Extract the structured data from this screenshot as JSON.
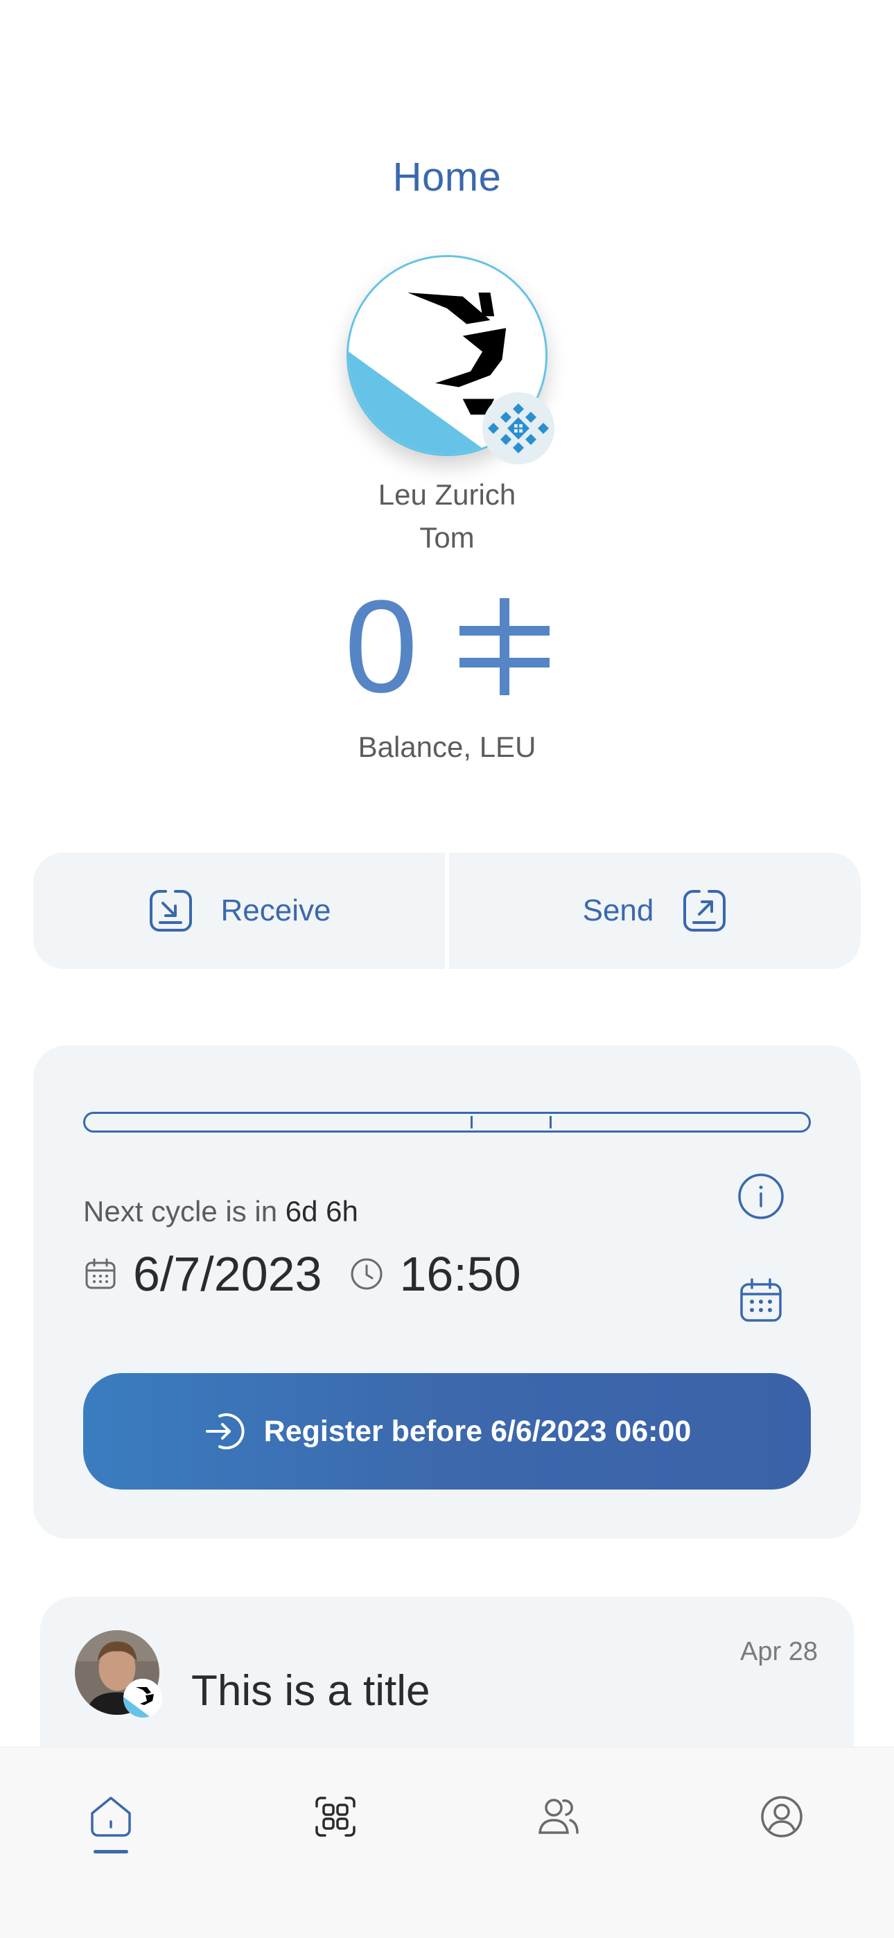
{
  "header": {
    "title": "Home"
  },
  "community": {
    "name": "Leu Zurich",
    "avatar_icon": "lion-logo-icon",
    "badge_icon": "community-pattern-icon"
  },
  "user": {
    "name": "Tom"
  },
  "balance": {
    "value": "0",
    "currency_icon": "leu-currency-icon",
    "label": "Balance, LEU"
  },
  "actions": {
    "receive_label": "Receive",
    "send_label": "Send"
  },
  "cycle": {
    "prefix": "Next cycle is in ",
    "remaining": "6d 6h",
    "date": "6/7/2023",
    "time": "16:50",
    "register_label": "Register before 6/6/2023 06:00"
  },
  "feed": {
    "items": [
      {
        "title": "This is a title",
        "date": "Apr 28"
      }
    ]
  },
  "tabs": [
    "home-icon",
    "qr-scan-icon",
    "contacts-icon",
    "profile-icon"
  ],
  "colors": {
    "accent": "#3a68ad",
    "card": "#f1f5f7",
    "brand_blue": "#64c3e6"
  }
}
